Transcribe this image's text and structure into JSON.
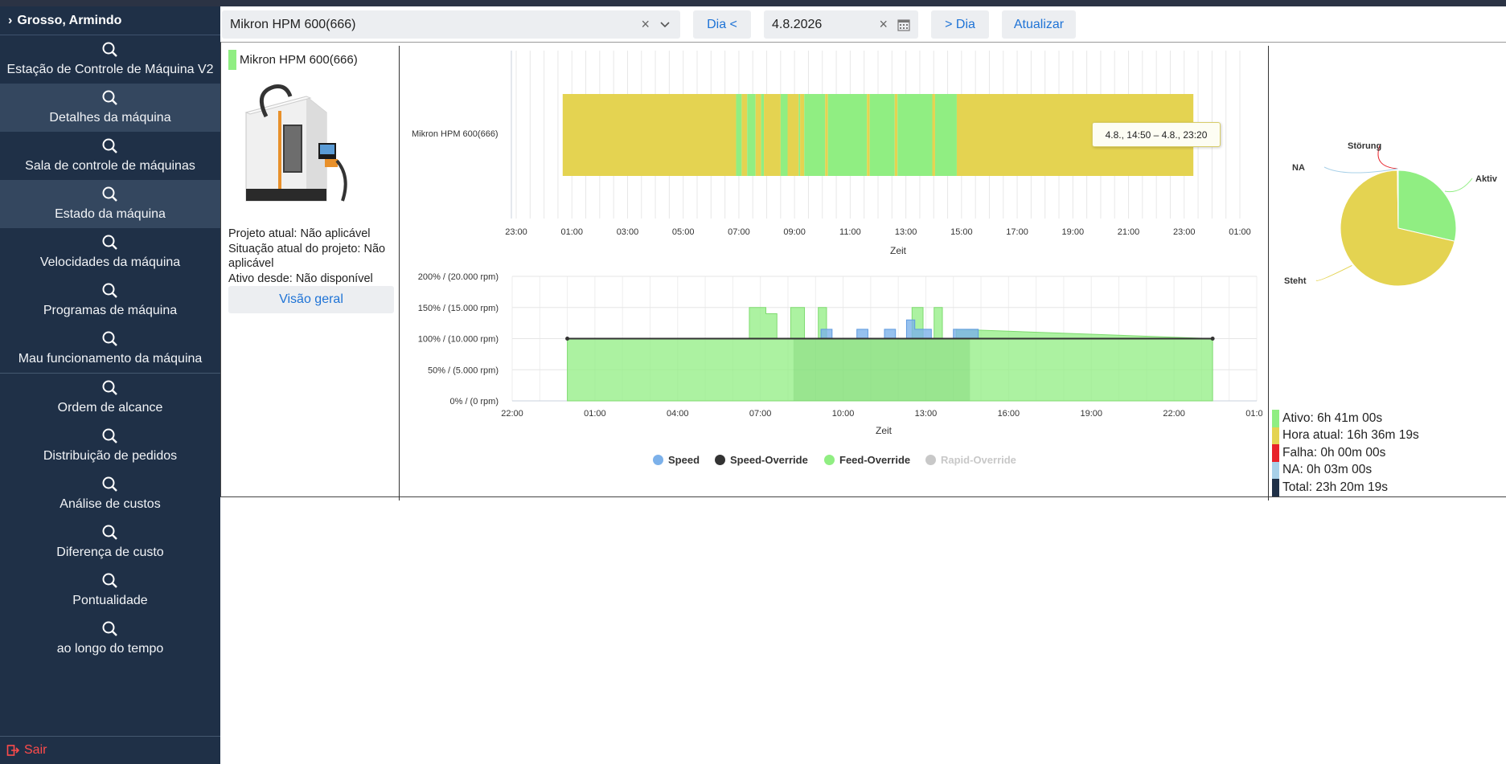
{
  "sidebar": {
    "user_name": "Grosso, Armindo",
    "items": [
      {
        "label": "Estação de Controle de Máquina V2",
        "active": false
      },
      {
        "label": "Detalhes da máquina",
        "active": true
      },
      {
        "label": "Sala de controle de máquinas",
        "active": false
      },
      {
        "label": "Estado da máquina",
        "active": true
      },
      {
        "label": "Velocidades da máquina",
        "active": false
      },
      {
        "label": "Programas de máquina",
        "active": false
      },
      {
        "label": "Mau funcionamento da máquina",
        "active": false
      },
      {
        "label": "Ordem de alcance",
        "active": false
      },
      {
        "label": "Distribuição de pedidos",
        "active": false
      },
      {
        "label": "Análise de custos",
        "active": false
      },
      {
        "label": "Diferença de custo",
        "active": false
      },
      {
        "label": "Pontualidade",
        "active": false
      },
      {
        "label": "ao longo do tempo",
        "active": false
      }
    ],
    "logout_label": "Sair"
  },
  "toolbar": {
    "machine_value": "Mikron HPM 600(666)",
    "prev_day_label": "Dia <",
    "date_value": "4.8.2026",
    "next_day_label": "> Dia",
    "refresh_label": "Atualizar"
  },
  "machine_panel": {
    "name": "Mikron HPM 600(666)",
    "current_project": "Projeto atual: Não aplicável",
    "project_status": "Situação atual do projeto: Não aplicável",
    "active_since": "Ativo desde: Não disponível",
    "overview_label": "Visão geral"
  },
  "colors": {
    "active": "#90ee82",
    "idle": "#e4d351",
    "fault": "#e8222a",
    "na": "#a8d0e8",
    "total": "#1f3047",
    "speed": "#7cb1ea",
    "speed_override": "#333333",
    "feed_override": "#90ee82",
    "rapid_override": "#c8c8c8",
    "accent": "#1e73d6"
  },
  "tooltip": "4.8., 14:50 – 4.8., 23:20",
  "chart_data": [
    {
      "type": "timeline",
      "category": "Mikron HPM 600(666)",
      "x_ticks": [
        "23:00",
        "01:00",
        "03:00",
        "05:00",
        "07:00",
        "09:00",
        "11:00",
        "13:00",
        "15:00",
        "17:00",
        "19:00",
        "21:00",
        "23:00",
        "01:00"
      ],
      "xlabel": "Zeit",
      "xlim_hours": [
        23,
        49
      ],
      "segments": [
        {
          "state": "idle",
          "start": 24.67,
          "end": 30.9
        },
        {
          "state": "active",
          "start": 30.9,
          "end": 31.1
        },
        {
          "state": "idle",
          "start": 31.1,
          "end": 31.3
        },
        {
          "state": "active",
          "start": 31.3,
          "end": 31.6
        },
        {
          "state": "idle",
          "start": 31.6,
          "end": 31.8
        },
        {
          "state": "active",
          "start": 31.8,
          "end": 31.9
        },
        {
          "state": "idle",
          "start": 31.9,
          "end": 32.5
        },
        {
          "state": "active",
          "start": 32.5,
          "end": 32.75
        },
        {
          "state": "idle",
          "start": 32.75,
          "end": 33.15
        },
        {
          "state": "active",
          "start": 33.15,
          "end": 33.2
        },
        {
          "state": "idle",
          "start": 33.2,
          "end": 33.35
        },
        {
          "state": "active",
          "start": 33.35,
          "end": 34.1
        },
        {
          "state": "idle",
          "start": 34.1,
          "end": 34.2
        },
        {
          "state": "active",
          "start": 34.2,
          "end": 35.6
        },
        {
          "state": "idle",
          "start": 35.6,
          "end": 35.7
        },
        {
          "state": "active",
          "start": 35.7,
          "end": 36.6
        },
        {
          "state": "idle",
          "start": 36.6,
          "end": 36.7
        },
        {
          "state": "active",
          "start": 36.7,
          "end": 37.95
        },
        {
          "state": "idle",
          "start": 37.95,
          "end": 38.05
        },
        {
          "state": "active",
          "start": 38.05,
          "end": 38.83
        },
        {
          "state": "idle",
          "start": 38.83,
          "end": 47.33
        }
      ]
    },
    {
      "type": "area",
      "xlabel": "Zeit",
      "x_ticks": [
        "22:00",
        "01:00",
        "04:00",
        "07:00",
        "10:00",
        "13:00",
        "16:00",
        "19:00",
        "22:00",
        "01:00"
      ],
      "xlim_hours": [
        22,
        49
      ],
      "y_ticks": [
        "0% / (0 rpm)",
        "50% / (5.000 rpm)",
        "100% / (10.000 rpm)",
        "150% / (15.000 rpm)",
        "200% / (20.000 rpm)"
      ],
      "ylim": [
        0,
        200
      ],
      "series": [
        {
          "name": "Speed",
          "points": [
            [
              33.2,
              100
            ],
            [
              33.2,
              115
            ],
            [
              33.6,
              115
            ],
            [
              33.6,
              100
            ],
            [
              34.5,
              100
            ],
            [
              34.5,
              115
            ],
            [
              34.9,
              115
            ],
            [
              34.9,
              100
            ],
            [
              35.5,
              100
            ],
            [
              35.5,
              115
            ],
            [
              35.9,
              115
            ],
            [
              35.9,
              100
            ],
            [
              36.3,
              100
            ],
            [
              36.3,
              130
            ],
            [
              36.6,
              130
            ],
            [
              36.6,
              115
            ],
            [
              37.2,
              115
            ],
            [
              37.2,
              100
            ],
            [
              38.0,
              100
            ],
            [
              38.0,
              115
            ],
            [
              38.9,
              115
            ],
            [
              38.9,
              100
            ]
          ]
        },
        {
          "name": "Speed-Override",
          "points": [
            [
              24.0,
              100
            ],
            [
              47.4,
              100
            ]
          ]
        },
        {
          "name": "Feed-Override",
          "points": [
            [
              24.0,
              0
            ],
            [
              24.0,
              100
            ],
            [
              30.6,
              100
            ],
            [
              30.6,
              150
            ],
            [
              31.2,
              150
            ],
            [
              31.2,
              140
            ],
            [
              31.6,
              140
            ],
            [
              31.6,
              100
            ],
            [
              32.1,
              100
            ],
            [
              32.1,
              150
            ],
            [
              32.6,
              150
            ],
            [
              32.6,
              100
            ],
            [
              33.1,
              100
            ],
            [
              33.1,
              150
            ],
            [
              33.4,
              150
            ],
            [
              33.4,
              100
            ],
            [
              36.5,
              100
            ],
            [
              36.5,
              150
            ],
            [
              36.9,
              150
            ],
            [
              36.9,
              100
            ],
            [
              37.3,
              100
            ],
            [
              37.3,
              150
            ],
            [
              37.6,
              150
            ],
            [
              37.6,
              100
            ],
            [
              38.1,
              100
            ],
            [
              38.1,
              115
            ],
            [
              47.4,
              100
            ],
            [
              47.4,
              0
            ]
          ]
        },
        {
          "name": "Rapid-Override",
          "hidden": true,
          "points": []
        }
      ]
    },
    {
      "type": "pie",
      "slices": [
        {
          "label": "Aktiv",
          "value": 401
        },
        {
          "label": "Steht",
          "value": 996
        },
        {
          "label": "Störung",
          "value": 0.5
        },
        {
          "label": "NA",
          "value": 3
        }
      ]
    }
  ],
  "stats": [
    {
      "label": "Ativo: 6h 41m 00s",
      "color_key": "active"
    },
    {
      "label": "Hora atual: 16h 36m 19s",
      "color_key": "idle"
    },
    {
      "label": "Falha: 0h 00m 00s",
      "color_key": "fault"
    },
    {
      "label": "NA: 0h 03m 00s",
      "color_key": "na"
    },
    {
      "label": "Total: 23h 20m 19s",
      "color_key": "total"
    }
  ]
}
